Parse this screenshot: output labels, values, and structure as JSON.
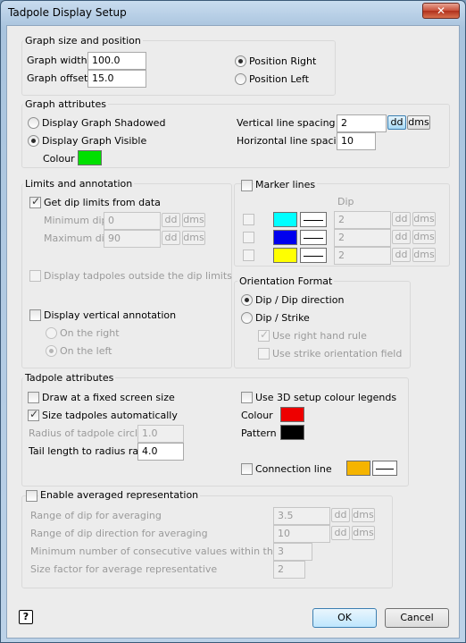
{
  "window": {
    "title": "Tadpole Display Setup",
    "close_glyph": "✕"
  },
  "graph_size": {
    "title": "Graph size and position",
    "width_label": "Graph width",
    "width_value": "100.0",
    "offset_label": "Graph offset",
    "offset_value": "15.0",
    "position_right": "Position Right",
    "position_left": "Position Left"
  },
  "graph_attributes": {
    "title": "Graph attributes",
    "shadowed": "Display Graph Shadowed",
    "visible": "Display Graph Visible",
    "colour_label": "Colour",
    "colour": "#00e000",
    "vertical_spacing_label": "Vertical line spacing",
    "vertical_spacing_value": "2",
    "horizontal_spacing_label": "Horizontal line spacing",
    "horizontal_spacing_value": "10",
    "dd": "dd",
    "dms": "dms"
  },
  "limits": {
    "title": "Limits and annotation",
    "get_dip_limits": "Get dip limits from data",
    "min_dip_label": "Minimum dip",
    "min_dip_value": "0",
    "max_dip_label": "Maximum dip",
    "max_dip_value": "90",
    "display_outside": "Display tadpoles outside the dip limits",
    "display_vertical": "Display vertical annotation",
    "on_right": "On the right",
    "on_left": "On the left",
    "dd": "dd",
    "dms": "dms"
  },
  "marker_lines": {
    "title": "Marker lines",
    "dip_header": "Dip",
    "rows": [
      {
        "colour": "#00ffff",
        "value": "2",
        "dd": "dd",
        "dms": "dms"
      },
      {
        "colour": "#0000ee",
        "value": "2",
        "dd": "dd",
        "dms": "dms"
      },
      {
        "colour": "#ffff00",
        "value": "2",
        "dd": "dd",
        "dms": "dms"
      }
    ]
  },
  "orientation": {
    "title": "Orientation Format",
    "dip_direction": "Dip / Dip direction",
    "dip_strike": "Dip / Strike",
    "right_hand_rule": "Use right hand rule",
    "strike_field": "Use strike orientation field"
  },
  "tadpole_attributes": {
    "title": "Tadpole attributes",
    "fixed_size": "Draw at a fixed screen size",
    "size_auto": "Size tadpoles automatically",
    "radius_label": "Radius of tadpole circle",
    "radius_value": "1.0",
    "tail_label": "Tail length to radius ratio",
    "tail_value": "4.0",
    "use_3d_legends": "Use 3D setup colour legends",
    "colour_label": "Colour",
    "colour": "#ee0000",
    "pattern_label": "Pattern",
    "pattern": "#000000",
    "connection_line": "Connection line",
    "connection_colour": "#f5b400"
  },
  "averaged": {
    "title": "Enable averaged representation",
    "range_dip_label": "Range of dip for averaging",
    "range_dip_value": "3.5",
    "range_dir_label": "Range of dip direction for averaging",
    "range_dir_value": "10",
    "min_consecutive_label": "Minimum number of consecutive values within the range",
    "min_consecutive_value": "3",
    "size_factor_label": "Size factor for average representative",
    "size_factor_value": "2",
    "dd": "dd",
    "dms": "dms"
  },
  "footer": {
    "help_glyph": "?",
    "ok": "OK",
    "cancel": "Cancel"
  }
}
